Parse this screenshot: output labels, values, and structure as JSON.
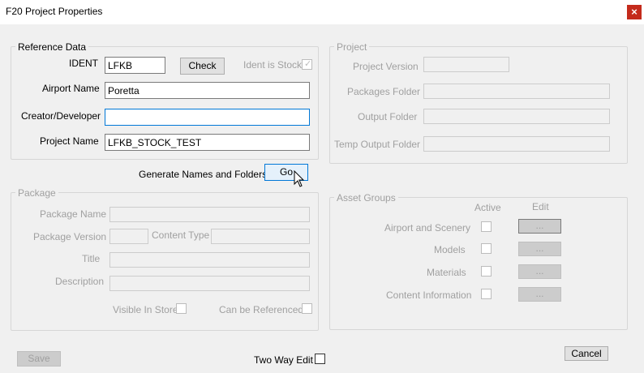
{
  "window": {
    "title": "F20 Project Properties",
    "close": "×"
  },
  "reference": {
    "legend": "Reference Data",
    "ident_label": "IDENT",
    "ident_value": "LFKB",
    "check_button": "Check",
    "ident_stock_label": "Ident is Stock",
    "airport_label": "Airport Name",
    "airport_value": "Poretta",
    "creator_label": "Creator/Developer",
    "creator_value": "",
    "project_name_label": "Project Name",
    "project_name_value": "LFKB_STOCK_TEST"
  },
  "generate": {
    "label": "Generate Names and Folders",
    "go_button": "Go"
  },
  "project": {
    "legend": "Project",
    "version_label": "Project Version",
    "packages_label": "Packages Folder",
    "output_label": "Output Folder",
    "temp_output_label": "Temp Output Folder"
  },
  "package": {
    "legend": "Package",
    "name_label": "Package Name",
    "version_label": "Package Version",
    "content_type_label": "Content Type",
    "title_label": "Title",
    "description_label": "Description",
    "visible_store_label": "Visible In Store",
    "referenced_label": "Can be Referenced"
  },
  "asset_groups": {
    "legend": "Asset Groups",
    "active_header": "Active",
    "edit_header": "Edit",
    "rows": [
      {
        "label": "Airport and Scenery",
        "edit": "..."
      },
      {
        "label": "Models",
        "edit": "..."
      },
      {
        "label": "Materials",
        "edit": "..."
      },
      {
        "label": "Content Information",
        "edit": "..."
      }
    ]
  },
  "footer": {
    "save_button": "Save",
    "two_way_label": "Two Way Edit",
    "cancel_button": "Cancel"
  }
}
